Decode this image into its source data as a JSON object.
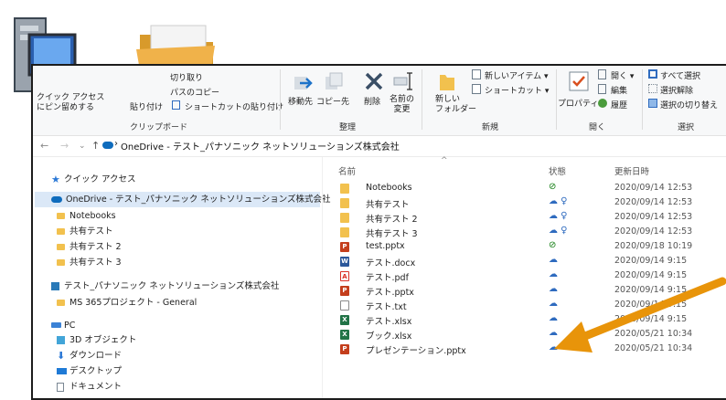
{
  "ribbon": {
    "clipboard": {
      "cut_label": "切り取り",
      "copy_path_label": "パスのコピー",
      "paste_shortcut_label": "ショートカットの貼り付け",
      "pin_label": "クイック アクセス\nにピン留めする",
      "paste_label": "貼り付け",
      "group_label": "クリップボード"
    },
    "organize": {
      "move_to": "移動先",
      "copy_to": "コピー先",
      "delete": "削除",
      "rename": "名前の\n変更",
      "group_label": "整理"
    },
    "new": {
      "new_folder": "新しい\nフォルダー",
      "new_item": "新しいアイテム ▾",
      "shortcut": "ショートカット ▾",
      "group_label": "新規"
    },
    "open": {
      "properties": "プロパティ",
      "open": "開く ▾",
      "edit": "編集",
      "history": "履歴",
      "group_label": "開く"
    },
    "select": {
      "select_all": "すべて選択",
      "select_none": "選択解除",
      "invert": "選択の切り替え",
      "group_label": "選択"
    }
  },
  "address": {
    "path": "OneDrive - テスト_パナソニック ネットソリューションズ株式会社"
  },
  "nav": {
    "items": [
      {
        "label": "クイック アクセス"
      },
      {
        "label": "OneDrive - テスト_パナソニック ネットソリューションズ株式会社"
      },
      {
        "label": "Notebooks"
      },
      {
        "label": "共有テスト"
      },
      {
        "label": "共有テスト 2"
      },
      {
        "label": "共有テスト 3"
      },
      {
        "label": "テスト_パナソニック ネットソリューションズ株式会社"
      },
      {
        "label": "MS 365プロジェクト - General"
      },
      {
        "label": "PC"
      },
      {
        "label": "3D オブジェクト"
      },
      {
        "label": "ダウンロード"
      },
      {
        "label": "デスクトップ"
      },
      {
        "label": "ドキュメント"
      }
    ]
  },
  "list": {
    "headers": {
      "name": "名前",
      "status": "状態",
      "date": "更新日時"
    },
    "rows": [
      {
        "name": "Notebooks",
        "status": "⊘",
        "date": "2020/09/14 12:53",
        "type": "folder"
      },
      {
        "name": "共有テスト",
        "status": "☁ ♀",
        "date": "2020/09/14 12:53",
        "type": "folder"
      },
      {
        "name": "共有テスト 2",
        "status": "☁ ♀",
        "date": "2020/09/14 12:53",
        "type": "folder"
      },
      {
        "name": "共有テスト 3",
        "status": "☁ ♀",
        "date": "2020/09/14 12:53",
        "type": "folder"
      },
      {
        "name": "test.pptx",
        "status": "⊘",
        "date": "2020/09/18 10:19",
        "type": "pptx"
      },
      {
        "name": "テスト.docx",
        "status": "☁",
        "date": "2020/09/14 9:15",
        "type": "docx"
      },
      {
        "name": "テスト.pdf",
        "status": "☁",
        "date": "2020/09/14 9:15",
        "type": "pdf"
      },
      {
        "name": "テスト.pptx",
        "status": "☁",
        "date": "2020/09/14 9:15",
        "type": "pptx"
      },
      {
        "name": "テスト.txt",
        "status": "☁",
        "date": "2020/09/14 9:15",
        "type": "txt"
      },
      {
        "name": "テスト.xlsx",
        "status": "☁",
        "date": "2020/09/14 9:15",
        "type": "xlsx"
      },
      {
        "name": "ブック.xlsx",
        "status": "☁",
        "date": "2020/05/21 10:34",
        "type": "xlsx"
      },
      {
        "name": "プレゼンテーション.pptx",
        "status": "☁",
        "date": "2020/05/21 10:34",
        "type": "pptx"
      }
    ]
  },
  "colors": {
    "folder": "#f2c14e",
    "pptx": "#c43e1c",
    "docx": "#2b579a",
    "pdf": "#d93025",
    "xlsx": "#217346",
    "txt": "#8a8a8a",
    "onedrive": "#0f6cbd",
    "arrow": "#e8940a",
    "synced": "#107c10"
  }
}
